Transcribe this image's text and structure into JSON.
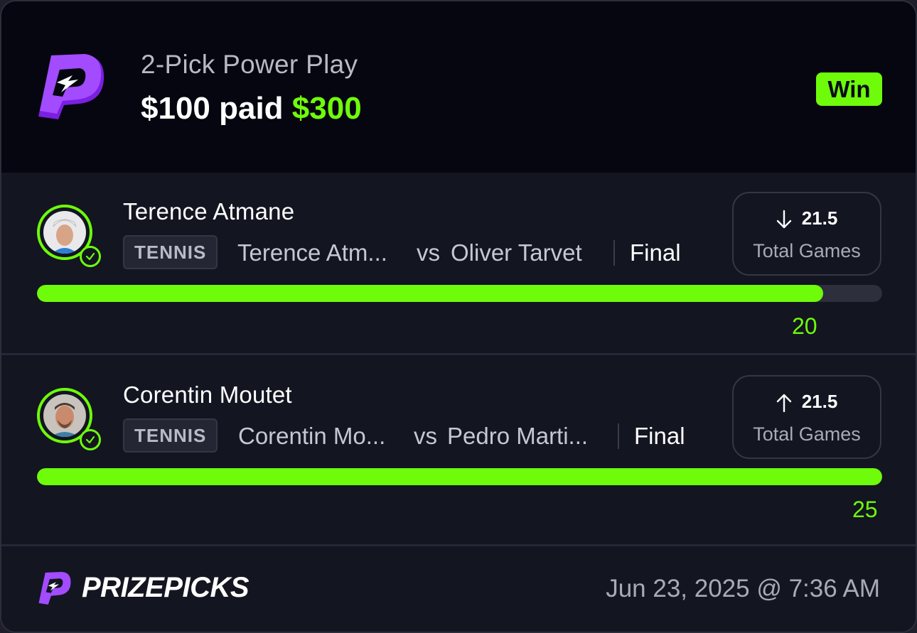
{
  "header": {
    "title": "2-Pick Power Play",
    "paid_prefix": "$100 paid",
    "paid_amount": "$300",
    "badge": "Win"
  },
  "picks": [
    {
      "player": "Terence Atmane",
      "sport": "TENNIS",
      "team_a": "Terence Atm...",
      "vs": "vs",
      "team_b": "Oliver Tarvet",
      "status": "Final",
      "direction": "down",
      "direction_icon": "arrow-down-icon",
      "line": "21.5",
      "stat": "Total Games",
      "result": "20",
      "progress": 0.93
    },
    {
      "player": "Corentin Moutet",
      "sport": "TENNIS",
      "team_a": "Corentin Mo...",
      "vs": "vs",
      "team_b": "Pedro Marti...",
      "status": "Final",
      "direction": "up",
      "direction_icon": "arrow-up-icon",
      "line": "21.5",
      "stat": "Total Games",
      "result": "25",
      "progress": 1.0
    }
  ],
  "footer": {
    "brand": "PRIZEPICKS",
    "timestamp": "Jun 23, 2025 @ 7:36 AM"
  },
  "colors": {
    "accent": "#6efc0b",
    "brand_purple": "#8b2cf5",
    "background": "#131521",
    "header_bg": "#05060f"
  }
}
